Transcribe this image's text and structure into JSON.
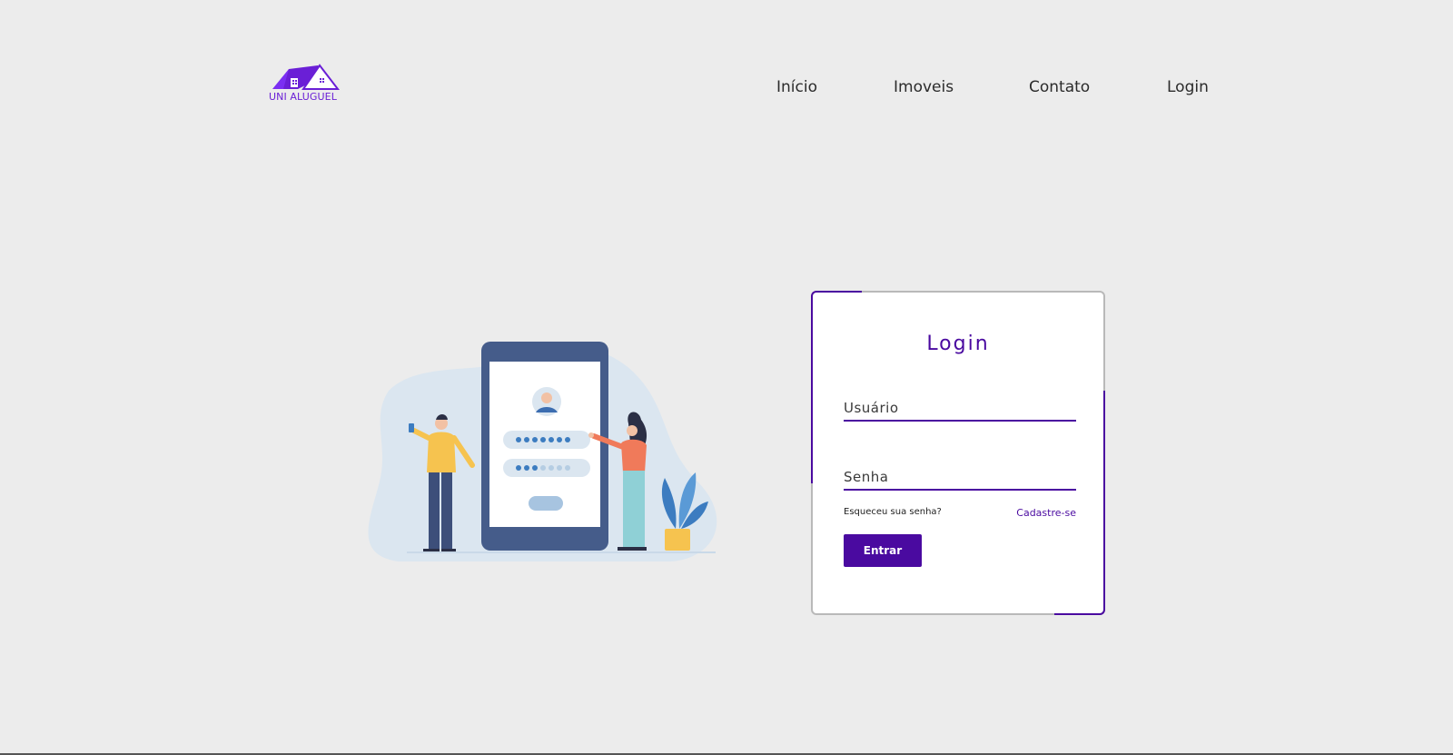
{
  "brand": {
    "name": "UNI ALUGUEL",
    "color": "#6a1fd6"
  },
  "nav": {
    "items": [
      "Início",
      "Imoveis",
      "Contato",
      "Login"
    ]
  },
  "login_card": {
    "title": "Login",
    "username_placeholder": "Usuário",
    "password_placeholder": "Senha",
    "forgot_label": "Esqueceu sua senha?",
    "signup_label": "Cadastre-se",
    "submit_label": "Entrar"
  },
  "colors": {
    "accent": "#4a0aa0",
    "background": "#ececec",
    "card": "#ffffff"
  },
  "icons": [
    "house-logo-icon",
    "login-illustration"
  ]
}
